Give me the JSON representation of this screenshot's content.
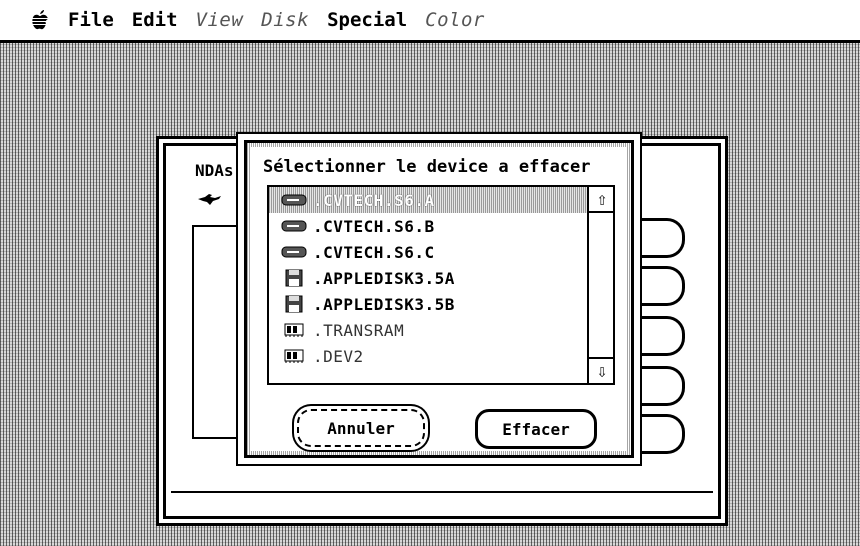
{
  "menubar": {
    "items": [
      {
        "label": "File",
        "enabled": true
      },
      {
        "label": "Edit",
        "enabled": true
      },
      {
        "label": "View",
        "enabled": false
      },
      {
        "label": "Disk",
        "enabled": false
      },
      {
        "label": "Special",
        "enabled": true
      },
      {
        "label": "Color",
        "enabled": false
      }
    ],
    "apple_icon": "apple-icon"
  },
  "background_window": {
    "title": "NDAs",
    "icon": "kangaroo-icon"
  },
  "dialog": {
    "title": "Sélectionner le device a effacer",
    "devices": [
      {
        "name": ".CVTECH.S6.A",
        "icon": "drive-icon",
        "selected": true
      },
      {
        "name": ".CVTECH.S6.B",
        "icon": "drive-icon",
        "selected": false
      },
      {
        "name": ".CVTECH.S6.C",
        "icon": "drive-icon",
        "selected": false
      },
      {
        "name": ".APPLEDISK3.5A",
        "icon": "floppy-icon",
        "selected": false
      },
      {
        "name": ".APPLEDISK3.5B",
        "icon": "floppy-icon",
        "selected": false
      },
      {
        "name": ".TRANSRAM",
        "icon": "ram-icon",
        "selected": false
      },
      {
        "name": ".DEV2",
        "icon": "ram-icon",
        "selected": false
      }
    ],
    "cancel_label": "Annuler",
    "confirm_label": "Effacer"
  }
}
